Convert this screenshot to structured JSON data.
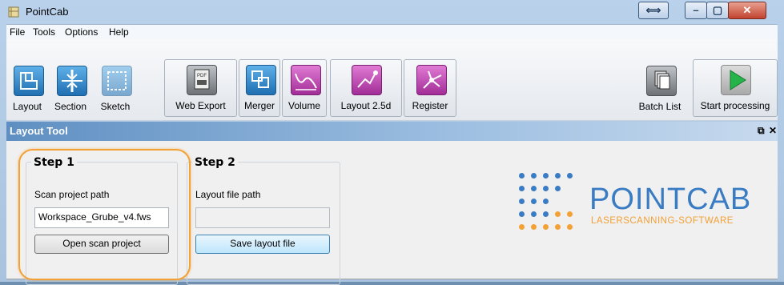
{
  "window": {
    "title": "PointCab"
  },
  "menu": [
    "File",
    "Tools",
    "Options",
    "Help"
  ],
  "toolbar": {
    "buttons": [
      {
        "label": "Layout",
        "icon": "layout-icon"
      },
      {
        "label": "Section",
        "icon": "section-icon"
      },
      {
        "label": "Sketch",
        "icon": "sketch-icon"
      },
      {
        "label": "Web Export",
        "icon": "pdf-export-icon"
      },
      {
        "label": "Merger",
        "icon": "merger-icon"
      },
      {
        "label": "Volume",
        "icon": "volume-icon"
      },
      {
        "label": "Layout 2.5d",
        "icon": "layout-25d-icon"
      },
      {
        "label": "Register",
        "icon": "register-icon"
      },
      {
        "label": "Batch List",
        "icon": "batch-list-icon"
      },
      {
        "label": "Start processing",
        "icon": "play-icon"
      }
    ]
  },
  "dock": {
    "title": "Layout Tool",
    "float_glyph": "⧉",
    "close_glyph": "✕"
  },
  "step1": {
    "title": "Step 1",
    "path_label": "Scan project path",
    "path_value": "Workspace_Grube_v4.fws",
    "open_button": "Open scan project"
  },
  "step2": {
    "title": "Step 2",
    "path_label": "Layout file path",
    "path_value": "",
    "save_button": "Save layout file"
  },
  "logo": {
    "main_point": "POINT",
    "main_cab": "CAB",
    "subtitle": "LASERSCANNING-SOFTWARE",
    "color_blue": "#3a7cc4",
    "color_orange": "#f3a034"
  },
  "colors": {
    "highlight": "#f3a034",
    "accent_purple": "#a22d97",
    "accent_blue": "#1f6fb2"
  }
}
